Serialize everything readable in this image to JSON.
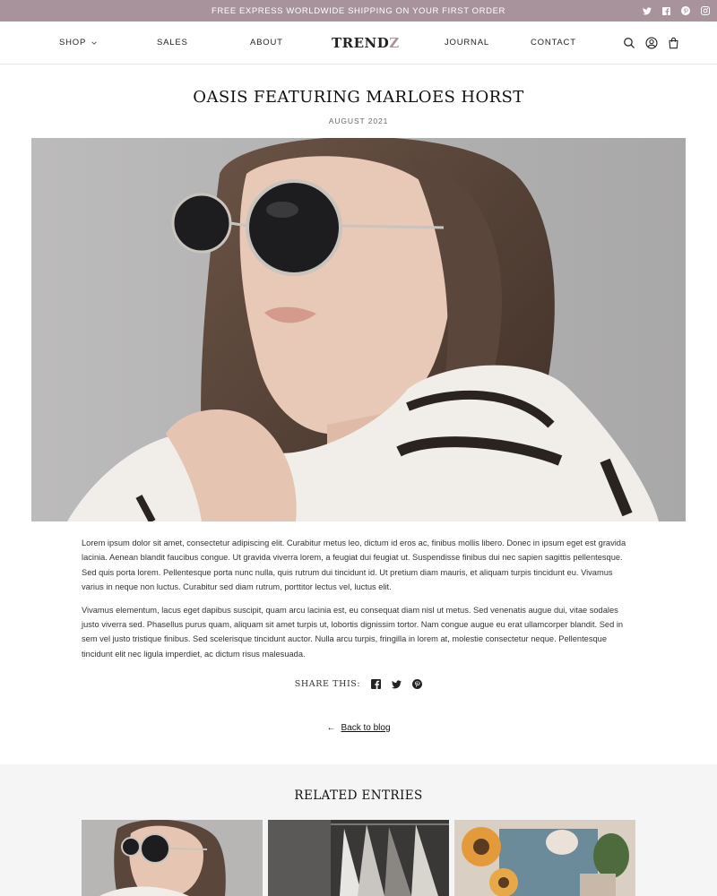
{
  "announcement": {
    "text": "FREE EXPRESS WORLDWIDE SHIPPING ON YOUR FIRST ORDER"
  },
  "social_top": [
    "twitter-icon",
    "facebook-icon",
    "pinterest-icon",
    "instagram-icon"
  ],
  "nav": {
    "shop": "SHOP",
    "sales": "SALES",
    "about": "ABOUT",
    "logo_main": "TREND",
    "logo_accent": "Z",
    "journal": "JOURNAL",
    "contact": "CONTACT",
    "icons": [
      "search-icon",
      "account-icon",
      "cart-icon"
    ]
  },
  "article": {
    "title": "OASIS FEATURING MARLOES HORST",
    "date": "AUGUST 2021",
    "paragraphs": [
      "Lorem ipsum dolor sit amet, consectetur adipiscing elit. Curabitur metus leo, dictum id eros ac, finibus mollis libero. Donec in ipsum eget est gravida lacinia. Aenean blandit faucibus congue. Ut gravida viverra lorem, a feugiat dui feugiat ut. Suspendisse finibus dui nec sapien sagittis pellentesque. Sed quis porta lorem. Pellentesque porta nunc nulla, quis rutrum dui tincidunt id. Ut pretium diam mauris, et aliquam turpis tincidunt eu. Vivamus varius in neque non luctus. Curabitur sed diam rutrum, porttitor lectus vel, luctus elit.",
      "Vivamus elementum, lacus eget dapibus suscipit, quam arcu lacinia est, eu consequat diam nisl ut metus. Sed venenatis augue dui, vitae sodales justo viverra sed. Phasellus purus quam, aliquam sit amet turpis ut, lobortis dignissim tortor. Nam congue augue eu erat ullamcorper blandit. Sed in sem vel justo tristique finibus. Sed scelerisque tincidunt auctor. Nulla arcu turpis, fringilla in lorem at, molestie consectetur neque. Pellentesque tincidunt elit nec ligula imperdiet, ac dictum risus malesuada."
    ]
  },
  "share": {
    "label": "SHARE THIS:",
    "icons": [
      "facebook-icon",
      "twitter-icon",
      "pinterest-icon"
    ]
  },
  "back": {
    "arrow": "←",
    "label": "Back to blog"
  },
  "related": {
    "title": "RELATED ENTRIES"
  },
  "colors": {
    "accent": "#a8939c",
    "related_bg": "#f5f5f5",
    "text": "#222222"
  }
}
